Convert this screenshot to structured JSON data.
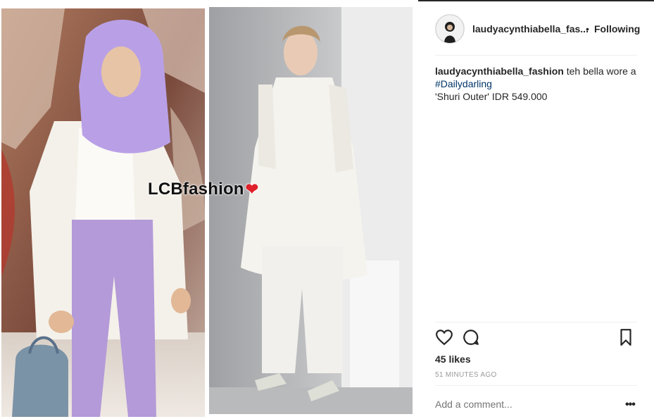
{
  "post": {
    "watermark": "LCBfashion",
    "watermark_heart": "❤"
  },
  "header": {
    "username": "laudyacynthiabella_fas...",
    "separator": "•",
    "follow_status": "Following"
  },
  "caption": {
    "username": "laudyacynthiabella_fashion",
    "text": " teh bella wore a",
    "hashtag": "#Dailydarling",
    "product": "'Shuri Outer' IDR 549.000"
  },
  "actions": {
    "like_icon": "heart-icon",
    "comment_icon": "comment-icon",
    "save_icon": "bookmark-icon"
  },
  "stats": {
    "likes": "45 likes",
    "time": "51 MINUTES AGO"
  },
  "comment": {
    "placeholder": "Add a comment...",
    "more": "•••"
  },
  "colors": {
    "text": "#262626",
    "muted": "#999999",
    "hashtag": "#003569",
    "divider": "#efefef"
  }
}
